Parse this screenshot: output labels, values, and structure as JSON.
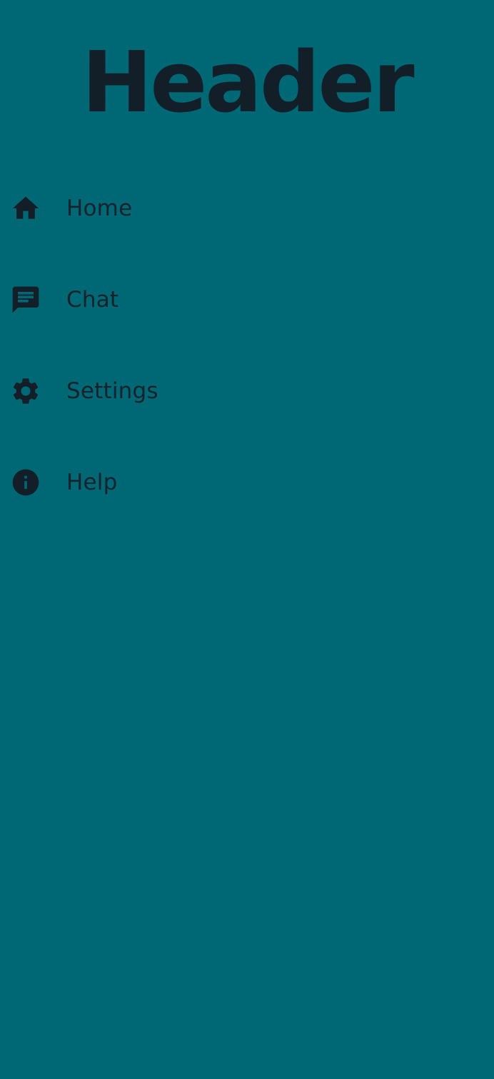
{
  "header": {
    "title": "Header"
  },
  "menu": {
    "items": [
      {
        "label": "Home",
        "icon": "home-icon"
      },
      {
        "label": "Chat",
        "icon": "chat-icon"
      },
      {
        "label": "Settings",
        "icon": "settings-gear-icon"
      },
      {
        "label": "Help",
        "icon": "info-icon"
      }
    ]
  },
  "colors": {
    "background": "#006775",
    "text": "#14202a"
  }
}
